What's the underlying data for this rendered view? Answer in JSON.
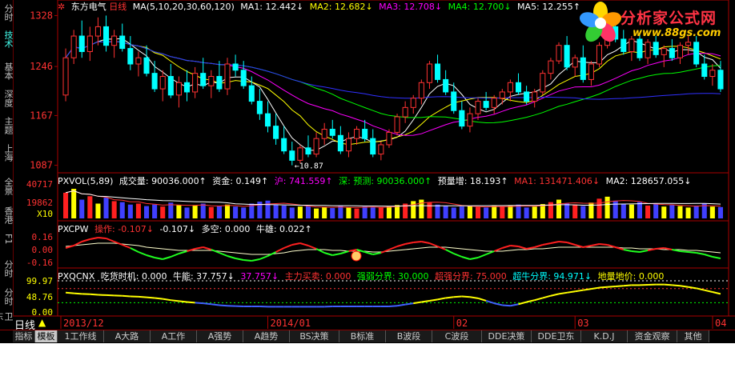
{
  "side_tabs": [
    {
      "label": "分时",
      "active": false
    },
    {
      "label": "技术",
      "active": true
    },
    {
      "label": "基本",
      "active": false
    },
    {
      "label": "深度",
      "active": false
    },
    {
      "label": "主题",
      "active": false
    },
    {
      "label": "上海",
      "active": false
    },
    {
      "label": "全景",
      "active": false
    },
    {
      "label": "香港",
      "active": false
    },
    {
      "label": "F1",
      "active": false
    },
    {
      "label": "分时",
      "active": false
    },
    {
      "label": "分时",
      "active": false
    },
    {
      "label": "卫东",
      "active": false
    }
  ],
  "main_header": {
    "stock_name": "东方电气",
    "period": "日线",
    "ma_def": "MA(5,10,20,30,60,120)",
    "ma1": "MA1: 12.442↓",
    "ma2": "MA2: 12.682↓",
    "ma3": "MA3: 12.708↓",
    "ma4": "MA4: 12.700↓",
    "ma5": "MA5: 12.255↑"
  },
  "vol_header": {
    "title": "PXVOL(5,89)",
    "volume": "成交量: 90036.000↑",
    "capital": "资金: 0.149↑",
    "hu": "沪: 741.559↑",
    "shen": "深: 预测: 90036.000↑",
    "forecast": "预量增: 18.193↑",
    "ma1": "MA1: 131471.406↓",
    "ma2": "MA2: 128657.055↓"
  },
  "cpw_header": {
    "title": "PXCPW",
    "op": "操作: -0.107↓",
    "val2": "-0.107↓",
    "duokong": "多空: 0.000",
    "niuxiong": "牛雄: 0.022↑"
  },
  "qcnx_header": {
    "title": "PXQCNX",
    "timing": "吃货时机: 0.000",
    "niuneng": "牛能: 37.757↓",
    "v2": "37.757↓",
    "zhuli": "主力买卖: 0.000",
    "qiangruo": "强弱分界: 30.000",
    "chaoqiang": "超强分界: 75.000",
    "chaoniu": "超牛分界: 94.971↓",
    "diji": "地量地价: 0.000"
  },
  "logo": {
    "title": "分析家公式网",
    "url": "www.88gs.com"
  },
  "bottom_bar": {
    "period_label": "日线",
    "date_marks": [
      {
        "label": "2013/12"
      },
      {
        "label": "2014/01"
      },
      {
        "label": "02"
      },
      {
        "label": "03"
      },
      {
        "label": "04"
      }
    ]
  },
  "bottom_tabs": [
    {
      "label": "指标",
      "active": false
    },
    {
      "label": "模板",
      "active": true
    },
    {
      "label": "1工作线",
      "active": false
    },
    {
      "label": "A大路",
      "active": false
    },
    {
      "label": "A工作",
      "active": false
    },
    {
      "label": "A强势",
      "active": false
    },
    {
      "label": "A趋势",
      "active": false
    },
    {
      "label": "BS决策",
      "active": false
    },
    {
      "label": "B标准",
      "active": false
    },
    {
      "label": "B波段",
      "active": false
    },
    {
      "label": "C波段",
      "active": false
    },
    {
      "label": "DDE决策",
      "active": false
    },
    {
      "label": "DDE卫东",
      "active": false
    },
    {
      "label": "K.D.J",
      "active": false
    },
    {
      "label": "资金观察",
      "active": false
    },
    {
      "label": "其他",
      "active": false
    }
  ],
  "colors": {
    "up": "#ff3232",
    "down": "#00ffff",
    "ma1": "#ffffff",
    "ma2": "#ffff00",
    "ma3": "#ff00ff",
    "ma4": "#00ff00",
    "ma5": "#3030ff",
    "frame": "#aa0000",
    "vol_yellow": "#ffff00",
    "vol_blue": "#4040ff",
    "vol_red": "#ff2020"
  },
  "chart_data": [
    {
      "type": "candlestick",
      "name": "price",
      "y_ticks": [
        13.28,
        12.46,
        11.67,
        10.87
      ],
      "ylim": [
        10.8,
        13.35
      ],
      "low_annotation": "←10.87",
      "ohlc": [
        [
          12.0,
          12.75,
          11.9,
          12.6
        ],
        [
          12.6,
          13.05,
          12.5,
          12.95
        ],
        [
          12.95,
          13.2,
          12.6,
          12.7
        ],
        [
          12.7,
          13.1,
          12.55,
          12.95
        ],
        [
          12.95,
          13.25,
          12.8,
          13.1
        ],
        [
          13.1,
          13.28,
          12.7,
          12.8
        ],
        [
          12.8,
          13.05,
          12.6,
          12.95
        ],
        [
          12.95,
          13.15,
          12.7,
          12.75
        ],
        [
          12.75,
          12.95,
          12.4,
          12.5
        ],
        [
          12.5,
          12.7,
          12.3,
          12.6
        ],
        [
          12.6,
          12.8,
          12.3,
          12.35
        ],
        [
          12.35,
          12.55,
          12.05,
          12.1
        ],
        [
          12.1,
          12.4,
          11.9,
          12.3
        ],
        [
          12.3,
          12.5,
          11.95,
          12.0
        ],
        [
          12.0,
          12.3,
          11.8,
          12.2
        ],
        [
          12.2,
          12.4,
          11.9,
          12.05
        ],
        [
          12.05,
          12.45,
          11.95,
          12.35
        ],
        [
          12.35,
          12.6,
          12.1,
          12.15
        ],
        [
          12.15,
          12.4,
          11.95,
          12.3
        ],
        [
          12.3,
          12.55,
          12.05,
          12.1
        ],
        [
          12.1,
          12.6,
          12.0,
          12.5
        ],
        [
          12.5,
          12.65,
          12.3,
          12.4
        ],
        [
          12.4,
          12.55,
          12.1,
          12.15
        ],
        [
          12.15,
          12.3,
          11.85,
          11.9
        ],
        [
          11.9,
          12.1,
          11.6,
          11.7
        ],
        [
          11.7,
          11.9,
          11.4,
          11.5
        ],
        [
          11.5,
          11.7,
          11.2,
          11.3
        ],
        [
          11.3,
          11.5,
          11.05,
          11.1
        ],
        [
          11.1,
          11.25,
          10.87,
          10.95
        ],
        [
          10.95,
          11.2,
          10.9,
          11.15
        ],
        [
          11.15,
          11.35,
          11.0,
          11.05
        ],
        [
          11.05,
          11.4,
          11.0,
          11.3
        ],
        [
          11.3,
          11.55,
          11.2,
          11.45
        ],
        [
          11.45,
          11.6,
          11.3,
          11.35
        ],
        [
          11.35,
          11.5,
          11.05,
          11.1
        ],
        [
          11.1,
          11.4,
          11.0,
          11.3
        ],
        [
          11.3,
          11.5,
          11.2,
          11.45
        ],
        [
          11.45,
          11.6,
          11.25,
          11.3
        ],
        [
          11.3,
          11.45,
          11.0,
          11.05
        ],
        [
          11.05,
          11.25,
          10.95,
          11.2
        ],
        [
          11.2,
          11.45,
          11.15,
          11.4
        ],
        [
          11.4,
          11.7,
          11.35,
          11.65
        ],
        [
          11.65,
          11.9,
          11.55,
          11.8
        ],
        [
          11.8,
          12.0,
          11.7,
          11.95
        ],
        [
          11.95,
          12.25,
          11.85,
          12.2
        ],
        [
          12.2,
          12.55,
          12.1,
          12.5
        ],
        [
          12.5,
          12.65,
          12.2,
          12.25
        ],
        [
          12.25,
          12.4,
          12.0,
          12.05
        ],
        [
          12.05,
          12.2,
          11.7,
          11.75
        ],
        [
          11.75,
          11.9,
          11.45,
          11.5
        ],
        [
          11.5,
          11.8,
          11.4,
          11.7
        ],
        [
          11.7,
          11.95,
          11.6,
          11.9
        ],
        [
          11.9,
          12.05,
          11.75,
          11.8
        ],
        [
          11.8,
          12.0,
          11.7,
          11.95
        ],
        [
          11.95,
          12.1,
          11.85,
          12.05
        ],
        [
          12.05,
          12.25,
          11.9,
          12.2
        ],
        [
          12.2,
          12.35,
          12.0,
          12.05
        ],
        [
          12.05,
          12.15,
          11.85,
          11.9
        ],
        [
          11.9,
          12.1,
          11.8,
          12.05
        ],
        [
          12.05,
          12.4,
          12.0,
          12.35
        ],
        [
          12.35,
          12.6,
          12.25,
          12.55
        ],
        [
          12.55,
          12.85,
          12.5,
          12.8
        ],
        [
          12.8,
          12.95,
          12.4,
          12.45
        ],
        [
          12.45,
          12.65,
          12.3,
          12.6
        ],
        [
          12.6,
          12.8,
          12.2,
          12.25
        ],
        [
          12.25,
          12.55,
          12.15,
          12.5
        ],
        [
          12.5,
          12.85,
          12.45,
          12.8
        ],
        [
          12.8,
          13.15,
          12.75,
          13.1
        ],
        [
          13.1,
          13.25,
          12.85,
          12.9
        ],
        [
          12.9,
          13.05,
          12.65,
          12.7
        ],
        [
          12.7,
          12.95,
          12.55,
          12.9
        ],
        [
          12.9,
          13.0,
          12.55,
          12.6
        ],
        [
          12.6,
          12.9,
          12.5,
          12.85
        ],
        [
          12.85,
          12.95,
          12.6,
          12.65
        ],
        [
          12.65,
          12.8,
          12.45,
          12.75
        ],
        [
          12.75,
          12.9,
          12.55,
          12.6
        ],
        [
          12.6,
          12.85,
          12.5,
          12.8
        ],
        [
          12.8,
          12.95,
          12.65,
          12.85
        ],
        [
          12.85,
          12.95,
          12.45,
          12.5
        ],
        [
          12.5,
          12.65,
          12.25,
          12.3
        ],
        [
          12.3,
          12.5,
          12.15,
          12.4
        ],
        [
          12.4,
          12.55,
          12.05,
          12.1
        ]
      ]
    },
    {
      "type": "bar",
      "name": "volume",
      "y_ticks": [
        40717,
        19862
      ],
      "scale_label": "X10",
      "values": [
        52,
        60,
        38,
        45,
        30,
        42,
        35,
        33,
        28,
        30,
        25,
        28,
        24,
        32,
        27,
        22,
        26,
        30,
        23,
        25,
        28,
        24,
        22,
        30,
        34,
        36,
        28,
        26,
        22,
        24,
        25,
        20,
        23,
        21,
        26,
        22,
        20,
        24,
        23,
        22,
        25,
        27,
        30,
        35,
        38,
        33,
        28,
        25,
        22,
        24,
        26,
        23,
        22,
        25,
        24,
        26,
        28,
        22,
        24,
        29,
        33,
        38,
        30,
        28,
        25,
        32,
        40,
        44,
        36,
        30,
        28,
        33,
        26,
        29,
        24,
        27,
        25,
        22,
        26,
        30,
        24,
        23
      ]
    },
    {
      "type": "line",
      "name": "PXCPW",
      "y_ticks": [
        0.16,
        -0.0,
        -0.16
      ],
      "ylim": [
        -0.2,
        0.22
      ],
      "values": [
        0.02,
        0.05,
        0.1,
        0.13,
        0.15,
        0.14,
        0.1,
        0.06,
        0.02,
        -0.03,
        -0.07,
        -0.1,
        -0.12,
        -0.09,
        -0.05,
        -0.02,
        0.01,
        0.03,
        0.0,
        -0.04,
        -0.08,
        -0.11,
        -0.13,
        -0.14,
        -0.12,
        -0.08,
        -0.03,
        0.02,
        0.06,
        0.08,
        0.05,
        0.01,
        -0.04,
        -0.07,
        -0.05,
        -0.02,
        0.0,
        -0.03,
        -0.06,
        -0.04,
        0.0,
        0.04,
        0.07,
        0.09,
        0.1,
        0.08,
        0.04,
        0.0,
        -0.05,
        -0.09,
        -0.12,
        -0.1,
        -0.06,
        -0.02,
        0.02,
        0.05,
        0.04,
        0.01,
        0.03,
        0.06,
        0.08,
        0.1,
        0.09,
        0.06,
        0.03,
        0.05,
        0.07,
        0.06,
        0.03,
        0.0,
        -0.02,
        -0.03,
        -0.01,
        0.01,
        0.02,
        0.0,
        -0.02,
        -0.03,
        -0.04,
        -0.06,
        -0.09,
        -0.11
      ],
      "ref_line": [
        0.04,
        0.05,
        0.06,
        0.07,
        0.08,
        0.08,
        0.08,
        0.07,
        0.06,
        0.05,
        0.03,
        0.02,
        0.01,
        0.0,
        -0.01,
        -0.01,
        -0.01,
        -0.01,
        -0.01,
        -0.02,
        -0.03,
        -0.04,
        -0.05,
        -0.06,
        -0.06,
        -0.06,
        -0.05,
        -0.04,
        -0.02,
        -0.01,
        0.0,
        0.0,
        0.0,
        -0.01,
        -0.01,
        -0.02,
        -0.02,
        -0.02,
        -0.03,
        -0.03,
        -0.02,
        -0.01,
        0.0,
        0.01,
        0.02,
        0.03,
        0.03,
        0.03,
        0.02,
        0.01,
        0.0,
        -0.01,
        -0.02,
        -0.02,
        -0.02,
        -0.01,
        0.0,
        0.0,
        0.01,
        0.01,
        0.02,
        0.03,
        0.03,
        0.03,
        0.03,
        0.03,
        0.03,
        0.03,
        0.03,
        0.02,
        0.02,
        0.01,
        0.01,
        0.01,
        0.0,
        0.0,
        0.0,
        -0.01,
        -0.01,
        -0.02,
        -0.03,
        -0.04
      ]
    },
    {
      "type": "line",
      "name": "PXQCNX",
      "y_ticks": [
        99.97,
        48.76,
        0.0
      ],
      "ylim": [
        -5,
        105
      ],
      "values": [
        62,
        60,
        58,
        57,
        55,
        54,
        53,
        52,
        50,
        49,
        47,
        45,
        42,
        38,
        35,
        32,
        30,
        28,
        25,
        22,
        20,
        19,
        18,
        18,
        18,
        17,
        17,
        17,
        17,
        17,
        17,
        17,
        17,
        18,
        18,
        18,
        18,
        18,
        18,
        18,
        18,
        20,
        24,
        28,
        32,
        36,
        40,
        45,
        48,
        50,
        48,
        44,
        36,
        28,
        22,
        20,
        25,
        32,
        38,
        45,
        52,
        58,
        62,
        66,
        70,
        74,
        78,
        80,
        82,
        84,
        86,
        86,
        87,
        88,
        88,
        86,
        84,
        80,
        76,
        70,
        64,
        58
      ],
      "lines": [
        99.97,
        75.0,
        30.0
      ]
    }
  ]
}
